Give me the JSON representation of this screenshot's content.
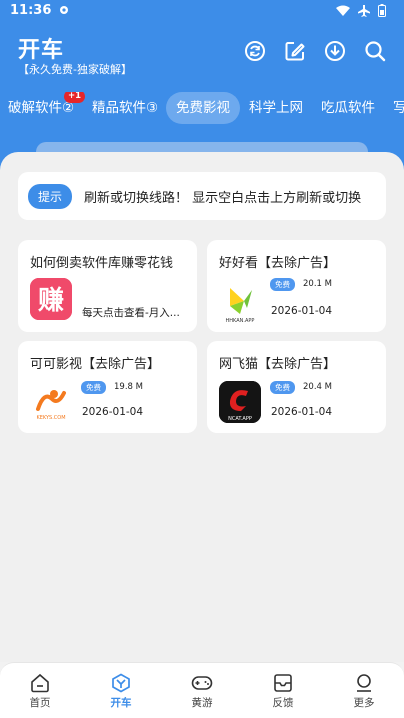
{
  "status_bar": {
    "time": "11:36"
  },
  "header": {
    "title": "开车",
    "subtitle": "【永久免费-独家破解】"
  },
  "tabs": [
    {
      "label": "破解软件②",
      "badge": "+1"
    },
    {
      "label": "精品软件③"
    },
    {
      "label": "免费影视",
      "active": true
    },
    {
      "label": "科学上网"
    },
    {
      "label": "吃瓜软件"
    },
    {
      "label": "写"
    }
  ],
  "notice": {
    "tip": "提示",
    "text": "刷新或切换线路！  显示空白点击上方刷新或切换"
  },
  "apps": [
    {
      "name": "如何倒卖软件库赚零花钱",
      "logo_text": "赚",
      "desc": "每天点击查看-月入..."
    },
    {
      "name": "好好看【去除广告】",
      "tag": "免费",
      "size": "20.1 M",
      "date": "2026-01-04",
      "logo_text": "HHKAN.APP"
    },
    {
      "name": "可可影视【去除广告】",
      "tag": "免费",
      "size": "19.8 M",
      "date": "2026-01-04",
      "logo_text": "KEKYS.COM"
    },
    {
      "name": "网飞猫【去除广告】",
      "tag": "免费",
      "size": "20.4 M",
      "date": "2026-01-04",
      "logo_text": "NCAT.APP"
    }
  ],
  "bottom_nav": [
    {
      "label": "首页"
    },
    {
      "label": "开车",
      "active": true
    },
    {
      "label": "黄游"
    },
    {
      "label": "反馈"
    },
    {
      "label": "更多"
    }
  ],
  "colors": {
    "primary": "#3d8de8",
    "badge": "#e5262a"
  }
}
